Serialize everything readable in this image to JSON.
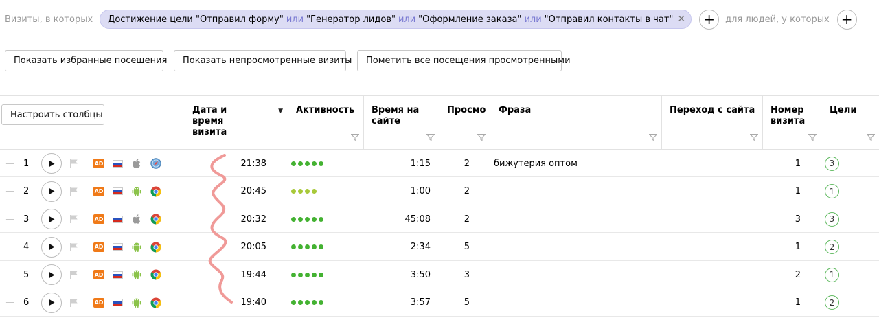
{
  "filter": {
    "prefix": "Визиты, в которых",
    "chip_parts": [
      {
        "text": "Достижение цели \"Отправил форму\"",
        "or": false
      },
      {
        "text": "или",
        "or": true
      },
      {
        "text": "\"Генератор лидов\"",
        "or": false
      },
      {
        "text": "или",
        "or": true
      },
      {
        "text": "\"Оформление заказа\"",
        "or": false
      },
      {
        "text": "или",
        "or": true
      },
      {
        "text": "\"Отправил контакты в чат\"",
        "or": false
      }
    ],
    "people_text": "для людей, у которых"
  },
  "actions": {
    "favorites": "Показать избранные посещения",
    "unviewed": "Показать непросмотренные визиты",
    "mark_all": "Пометить все посещения просмотренными"
  },
  "table": {
    "configure_button": "Настроить столбцы",
    "headers": {
      "datetime": "Дата и время визита",
      "activity": "Активность",
      "time_on_site": "Время на сайте",
      "views": "Просмо",
      "phrase": "Фраза",
      "referrer": "Переход с сайта",
      "visit_number": "Номер визита",
      "goals": "Цели"
    },
    "colors": {
      "activity_green": "#44b232",
      "activity_light": "#a8c93a",
      "ad_orange": "#f07a18",
      "goal_border": "#5cb85c"
    },
    "rows": [
      {
        "n": "1",
        "os": "apple",
        "browser": "safari",
        "time": "21:38",
        "activity_dots": 5,
        "activity_color": "green",
        "duration": "1:15",
        "views": "2",
        "phrase": "бижутерия оптом",
        "visit_num": "1",
        "goals": "3"
      },
      {
        "n": "2",
        "os": "android",
        "browser": "chrome",
        "time": "20:45",
        "activity_dots": 4,
        "activity_color": "light",
        "duration": "1:00",
        "views": "2",
        "phrase": "",
        "visit_num": "1",
        "goals": "1"
      },
      {
        "n": "3",
        "os": "apple",
        "browser": "chrome",
        "time": "20:32",
        "activity_dots": 5,
        "activity_color": "green",
        "duration": "45:08",
        "views": "2",
        "phrase": "",
        "visit_num": "3",
        "goals": "3"
      },
      {
        "n": "4",
        "os": "android",
        "browser": "chrome",
        "time": "20:05",
        "activity_dots": 5,
        "activity_color": "green",
        "duration": "2:34",
        "views": "5",
        "phrase": "",
        "visit_num": "1",
        "goals": "2"
      },
      {
        "n": "5",
        "os": "android",
        "browser": "chrome",
        "time": "19:44",
        "activity_dots": 5,
        "activity_color": "green",
        "duration": "3:50",
        "views": "3",
        "phrase": "",
        "visit_num": "2",
        "goals": "1"
      },
      {
        "n": "6",
        "os": "android",
        "browser": "chrome",
        "time": "19:40",
        "activity_dots": 5,
        "activity_color": "green",
        "duration": "3:57",
        "views": "5",
        "phrase": "",
        "visit_num": "1",
        "goals": "2"
      }
    ]
  }
}
